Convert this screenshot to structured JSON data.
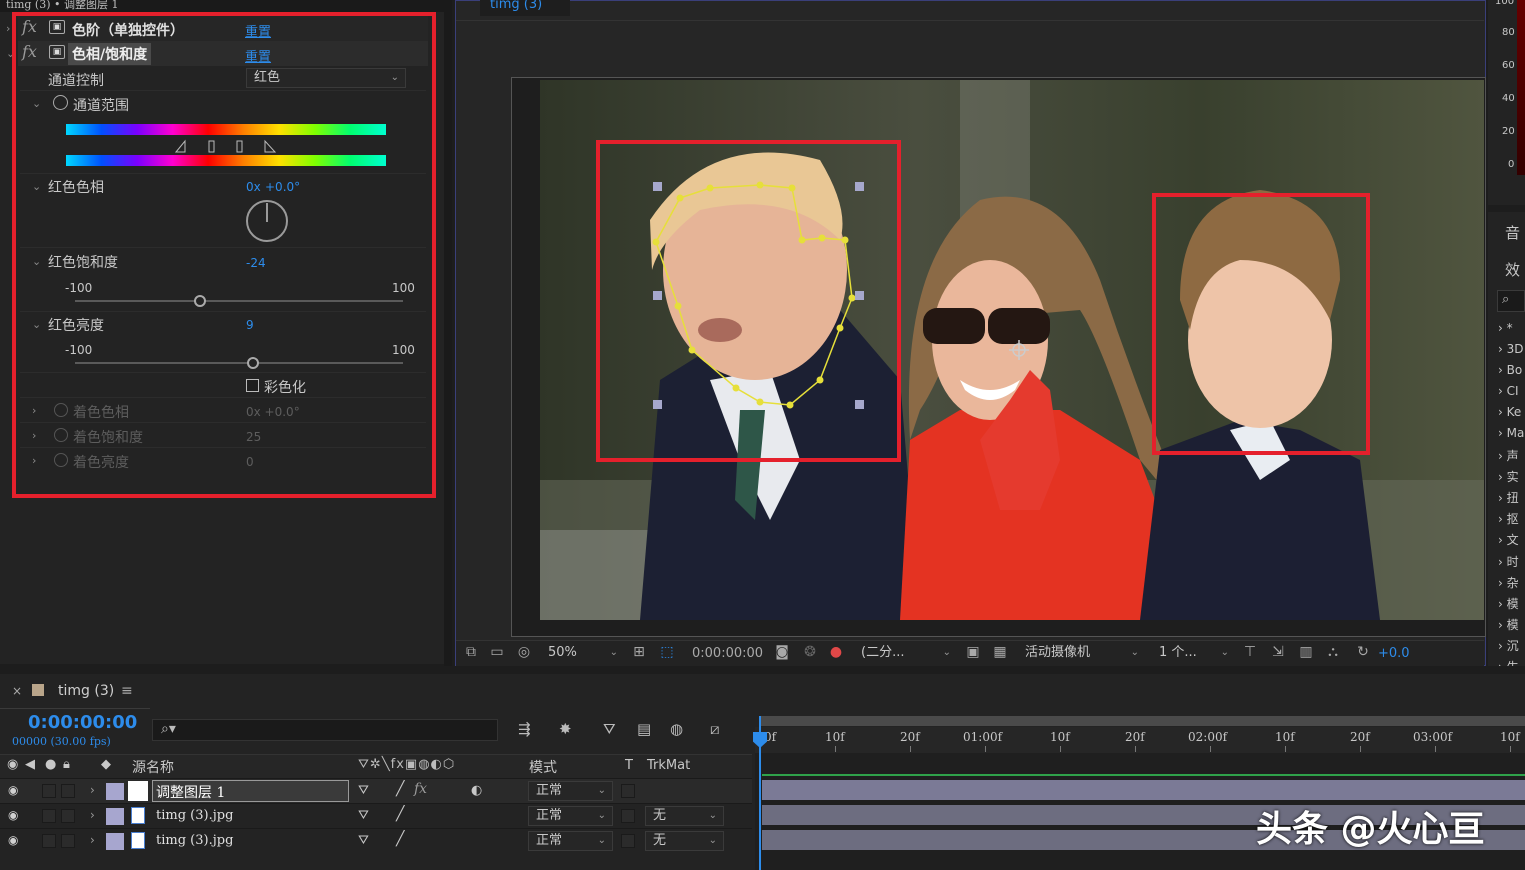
{
  "window": {
    "title": "timg (3) • 调整图层 1"
  },
  "effects": {
    "levels": {
      "name": "色阶（单独控件）",
      "reset": "重置"
    },
    "hue_sat": {
      "name": "色相/饱和度",
      "reset": "重置",
      "channel_control": {
        "label": "通道控制",
        "value": "红色"
      },
      "channel_range": {
        "label": "通道范围"
      },
      "hue": {
        "label": "红色色相",
        "prefix": "0x",
        "value": "+0.0°"
      },
      "saturation": {
        "label": "红色饱和度",
        "value": "-24",
        "min": "-100",
        "max": "100",
        "fraction": 0.38
      },
      "lightness": {
        "label": "红色亮度",
        "value": "9",
        "min": "-100",
        "max": "100",
        "fraction": 0.545
      },
      "colorize": {
        "label": "彩色化",
        "checked": false
      },
      "colorize_hue": {
        "label": "着色色相",
        "value": "0x +0.0°"
      },
      "colorize_sat": {
        "label": "着色饱和度",
        "value": "25"
      },
      "colorize_light": {
        "label": "着色亮度",
        "value": "0"
      }
    }
  },
  "viewer": {
    "tab": "timg (3)",
    "toolbar": {
      "zoom": "50%",
      "timecode": "0:00:00:00",
      "resolution": "(二分...",
      "camera": "活动摄像机",
      "views": "1 个...",
      "exposure": "+0.0"
    }
  },
  "audio_meter": {
    "labels": [
      "100",
      "80",
      "60",
      "40",
      "20",
      "0"
    ]
  },
  "right_panel": {
    "tabs": [
      "音",
      "效"
    ],
    "items": [
      "*",
      "3D",
      "Bo",
      "CI",
      "Ke",
      "Ma",
      "声",
      "实",
      "扭",
      "抠",
      "文",
      "时",
      "杂",
      "模",
      "模",
      "沉",
      "生"
    ]
  },
  "timeline": {
    "tab": "timg (3)",
    "timecode": "0:00:00:00",
    "frame_info": "00000 (30.00 fps)",
    "search_placeholder": "",
    "columns": {
      "source": "源名称",
      "mode": "模式",
      "t": "T",
      "trkmat": "TrkMat"
    },
    "ruler": [
      "0f",
      "10f",
      "20f",
      "01:00f",
      "10f",
      "20f",
      "02:00f",
      "10f",
      "20f",
      "03:00f",
      "10f"
    ],
    "layers": [
      {
        "name": "调整图层 1",
        "mode": "正常",
        "trkmat": ""
      },
      {
        "name": "timg (3).jpg",
        "mode": "正常",
        "trkmat": "无"
      },
      {
        "name": "timg (3).jpg",
        "mode": "正常",
        "trkmat": "无"
      }
    ]
  },
  "watermark": "头条 @火心亘",
  "colors": {
    "accent": "#2d8ceb",
    "highlight_frame": "#e5202c",
    "mask_path": "#e6df3a"
  }
}
